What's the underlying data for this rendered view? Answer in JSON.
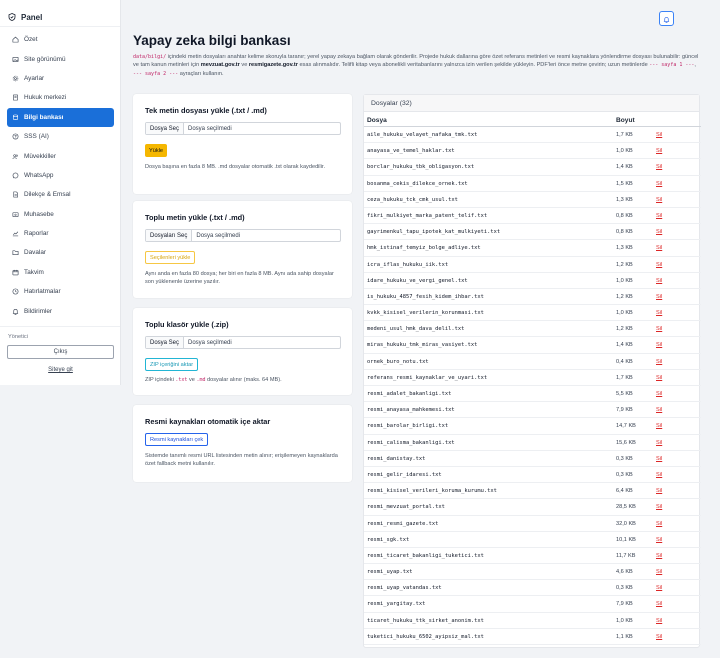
{
  "sidebar": {
    "brand": "Panel",
    "items": [
      {
        "label": "Özet",
        "icon": "home-icon"
      },
      {
        "label": "Site görünümü",
        "icon": "image-icon"
      },
      {
        "label": "Ayarlar",
        "icon": "gear-icon"
      },
      {
        "label": "Hukuk merkezi",
        "icon": "book-icon"
      },
      {
        "label": "Bilgi bankası",
        "icon": "database-icon",
        "active": true
      },
      {
        "label": "SSS (AI)",
        "icon": "question-icon"
      },
      {
        "label": "Müvekkiller",
        "icon": "users-icon"
      },
      {
        "label": "WhatsApp",
        "icon": "whatsapp-icon"
      },
      {
        "label": "Dilekçe & Emsal",
        "icon": "document-icon"
      },
      {
        "label": "Muhasebe",
        "icon": "wallet-icon"
      },
      {
        "label": "Raporlar",
        "icon": "chart-icon"
      },
      {
        "label": "Davalar",
        "icon": "folder-icon"
      },
      {
        "label": "Takvim",
        "icon": "calendar-icon"
      },
      {
        "label": "Hatırlatmalar",
        "icon": "clock-icon"
      },
      {
        "label": "Bildirimler",
        "icon": "bell-icon"
      }
    ],
    "role_label": "Yönetici",
    "logout_label": "Çıkış",
    "site_link_label": "Siteye git"
  },
  "page": {
    "title": "Yapay zeka bilgi bankası",
    "intro": {
      "code1": "data/bilgi/",
      "text1": " içindeki metin dosyaları anahtar kelime skoruyla taranır; yerel yapay zekaya bağlam olarak gönderilir. Projede hukuk dallarına göre özet referans metinleri ve resmi kaynaklara yönlendirme dosyası bulunabilir: güncel ve tam kanun metinleri için ",
      "bold1": "mevzuat.gov.tr",
      "text2": " ve ",
      "bold2": "resmigazete.gov.tr",
      "text3": " esas alınmalıdır. Telifli kitap veya abonelikli veritabanlarını yalnızca izin verilen şekilde yükleyin. PDF'leri önce metne çevirin; uzun metinlerde ",
      "code2": "--- sayfa 1 ---",
      "text4": ", ",
      "code3": "--- sayfa 2 ---",
      "text5": " ayraçları kullanın."
    }
  },
  "cards": {
    "single": {
      "title": "Tek metin dosyası yükle (.txt / .md)",
      "pick_label": "Dosya Seç",
      "none_label": "Dosya seçilmedi",
      "button_label": "Yükle",
      "hint": "Dosya başına en fazla 8 MB. .md dosyalar otomatik .txt olarak kaydedilir."
    },
    "bulk": {
      "title": "Toplu metin yükle (.txt / .md)",
      "pick_label": "Dosyaları Seç",
      "none_label": "Dosya seçilmedi",
      "button_label": "Seçilenleri yükle",
      "hint": "Aynı anda en fazla 80 dosya; her biri en fazla 8 MB. Aynı ada sahip dosyalar son yüklenenle üzerine yazılır."
    },
    "folder": {
      "title": "Toplu klasör yükle (.zip)",
      "pick_label": "Dosya Seç",
      "none_label": "Dosya seçilmedi",
      "button_label": "ZIP içeriğini aktar",
      "hint_pre": "ZIP içindeki ",
      "hint_code1": ".txt",
      "hint_mid": " ve ",
      "hint_code2": ".md",
      "hint_post": " dosyalar alınır (maks. 64 MB)."
    },
    "official": {
      "title": "Resmi kaynakları otomatik içe aktar",
      "button_label": "Resmi kaynakları çek",
      "hint": "Sistemde tanımlı resmi URL listesinden metin alınır; erişilemeyen kaynaklarda özet fallback metni kullanılır."
    }
  },
  "files": {
    "header": "Dosyalar (32)",
    "col_file": "Dosya",
    "col_size": "Boyut",
    "delete_label": "Sil",
    "rows": [
      {
        "name": "aile_hukuku_velayet_nafaka_tmk.txt",
        "size": "1,7 KB"
      },
      {
        "name": "anayasa_ve_temel_haklar.txt",
        "size": "1,0 KB"
      },
      {
        "name": "borclar_hukuku_tbk_obligasyon.txt",
        "size": "1,4 KB"
      },
      {
        "name": "bosanma_cekis_dilekce_ornek.txt",
        "size": "1,5 KB"
      },
      {
        "name": "ceza_hukuku_tck_cmk_usul.txt",
        "size": "1,3 KB"
      },
      {
        "name": "fikri_mulkiyet_marka_patent_telif.txt",
        "size": "0,8 KB"
      },
      {
        "name": "gayrimenkul_tapu_ipotek_kat_mulkiyeti.txt",
        "size": "0,8 KB"
      },
      {
        "name": "hmk_istinaf_temyiz_bolge_adliye.txt",
        "size": "1,3 KB"
      },
      {
        "name": "icra_iflas_hukuku_iik.txt",
        "size": "1,2 KB"
      },
      {
        "name": "idare_hukuku_ve_vergi_genel.txt",
        "size": "1,0 KB"
      },
      {
        "name": "is_hukuku_4857_fesih_kidem_ihbar.txt",
        "size": "1,2 KB"
      },
      {
        "name": "kvkk_kisisel_verilerin_korunmasi.txt",
        "size": "1,0 KB"
      },
      {
        "name": "medeni_usul_hmk_dava_delil.txt",
        "size": "1,2 KB"
      },
      {
        "name": "miras_hukuku_tmk_miras_vasiyet.txt",
        "size": "1,4 KB"
      },
      {
        "name": "ornek_buro_notu.txt",
        "size": "0,4 KB"
      },
      {
        "name": "referans_resmi_kaynaklar_ve_uyari.txt",
        "size": "1,7 KB"
      },
      {
        "name": "resmi_adalet_bakanligi.txt",
        "size": "5,5 KB"
      },
      {
        "name": "resmi_anayasa_mahkemesi.txt",
        "size": "7,9 KB"
      },
      {
        "name": "resmi_barolar_birligi.txt",
        "size": "14,7 KB"
      },
      {
        "name": "resmi_calisma_bakanligi.txt",
        "size": "15,6 KB"
      },
      {
        "name": "resmi_danistay.txt",
        "size": "0,3 KB"
      },
      {
        "name": "resmi_gelir_idaresi.txt",
        "size": "0,3 KB"
      },
      {
        "name": "resmi_kisisel_verileri_koruma_kurumu.txt",
        "size": "6,4 KB"
      },
      {
        "name": "resmi_mevzuat_portal.txt",
        "size": "28,5 KB"
      },
      {
        "name": "resmi_resmi_gazete.txt",
        "size": "32,0 KB"
      },
      {
        "name": "resmi_sgk.txt",
        "size": "10,1 KB"
      },
      {
        "name": "resmi_ticaret_bakanligi_tuketici.txt",
        "size": "11,7 KB"
      },
      {
        "name": "resmi_uyap.txt",
        "size": "4,6 KB"
      },
      {
        "name": "resmi_uyap_vatandas.txt",
        "size": "0,3 KB"
      },
      {
        "name": "resmi_yargitay.txt",
        "size": "7,9 KB"
      },
      {
        "name": "ticaret_hukuku_ttk_sirket_anonim.txt",
        "size": "1,0 KB"
      },
      {
        "name": "tuketici_hukuku_6502_ayipsiz_mal.txt",
        "size": "1,1 KB"
      }
    ]
  },
  "colors": {
    "accent": "#1a6fd9",
    "danger": "#dc2626",
    "warning": "#f5b700"
  }
}
